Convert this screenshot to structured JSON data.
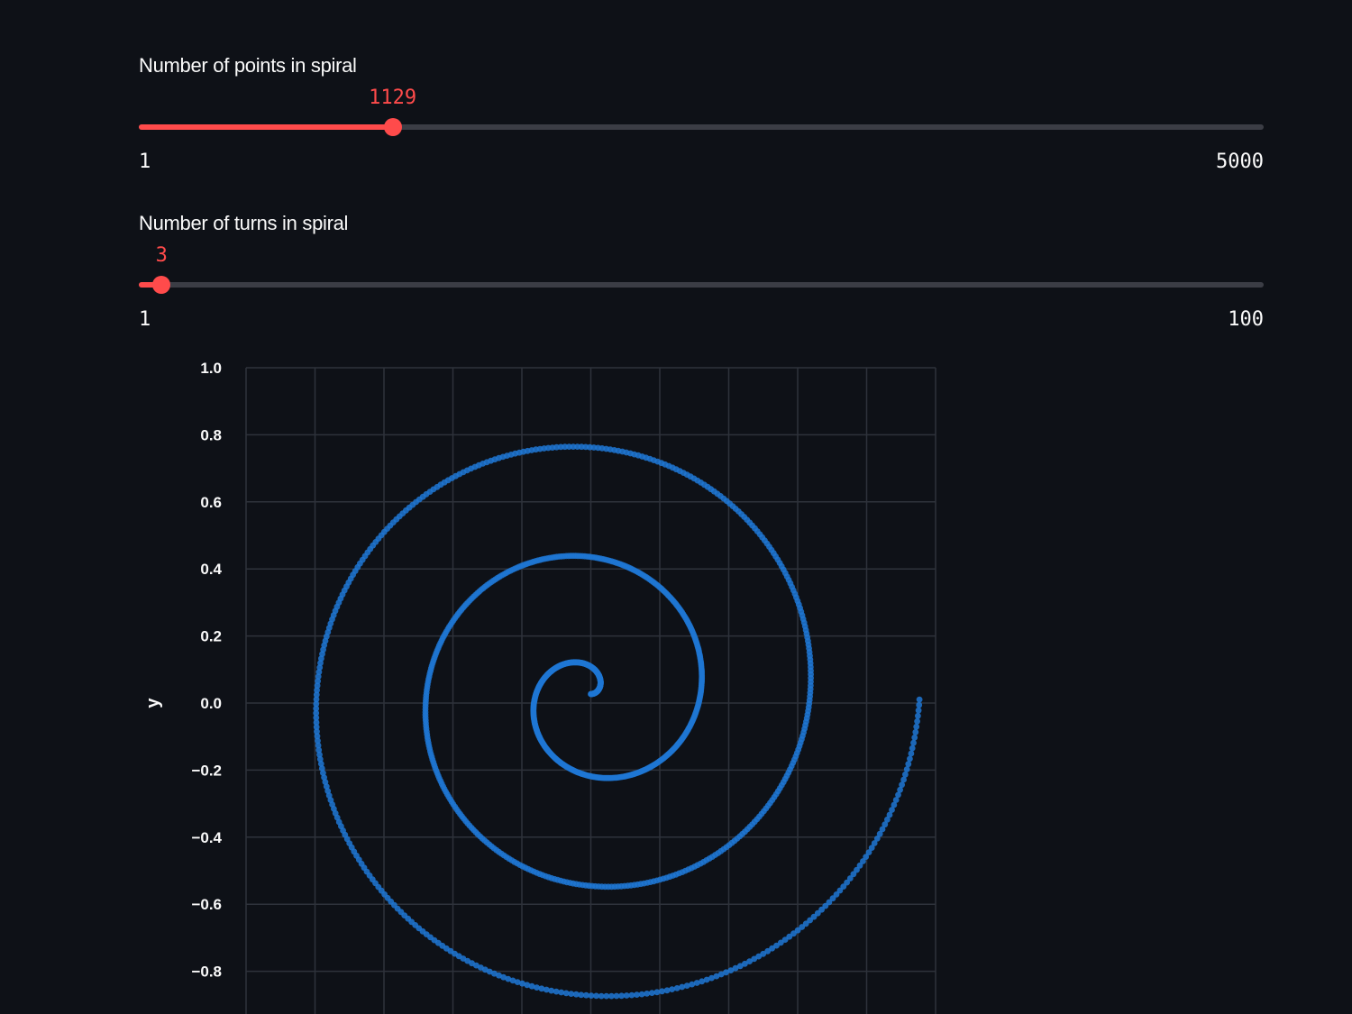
{
  "sliders": [
    {
      "label": "Number of points in spiral",
      "value": 1129,
      "value_text": "1129",
      "min": 1,
      "max": 5000,
      "min_text": "1",
      "max_text": "5000"
    },
    {
      "label": "Number of turns in spiral",
      "value": 3,
      "value_text": "3",
      "min": 1,
      "max": 100,
      "min_text": "1",
      "max_text": "100"
    }
  ],
  "colors": {
    "background": "#0e1117",
    "accent": "#ff4b4b",
    "track": "#3b3d45",
    "text": "#fafafa",
    "point": "#1f77d4",
    "grid": "#2e323b"
  },
  "chart_data": {
    "type": "scatter",
    "ylabel": "y",
    "ylim": [
      -0.9,
      1.0
    ],
    "xlim": [
      -1.0,
      1.0
    ],
    "yticks": [
      "1.0",
      "0.8",
      "0.6",
      "0.4",
      "0.2",
      "0.0",
      "−0.2",
      "−0.4",
      "−0.6",
      "−0.8"
    ],
    "ytick_values": [
      1.0,
      0.8,
      0.6,
      0.4,
      0.2,
      0.0,
      -0.2,
      -0.4,
      -0.6,
      -0.8
    ],
    "grid": true,
    "num_points": 1129,
    "num_turns": 3
  }
}
